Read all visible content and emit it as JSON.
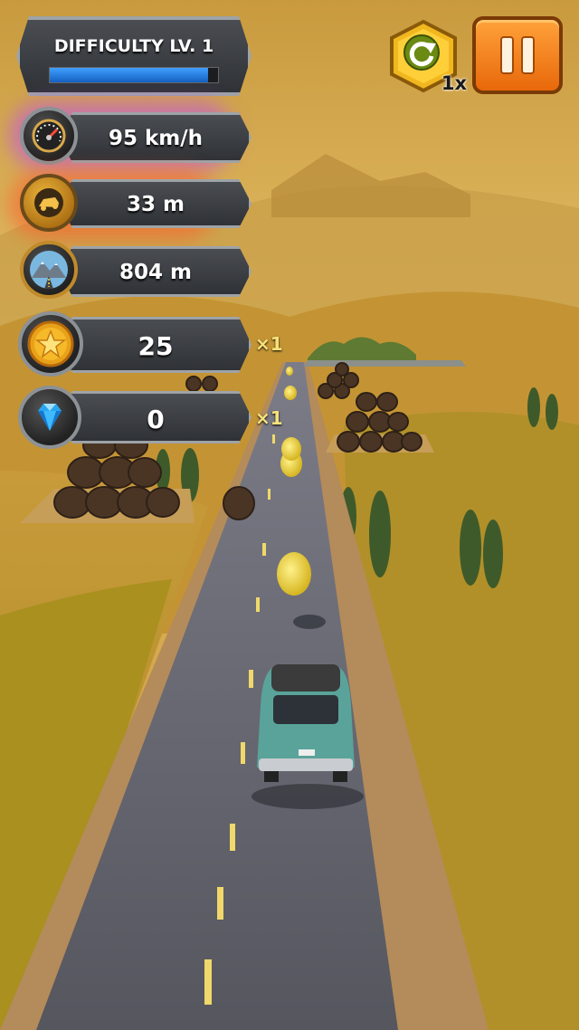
{
  "hud": {
    "difficulty": {
      "label": "DIFFICULTY LV. 1",
      "progress": 0.94,
      "bar_color": "#1e7fe0"
    },
    "speed": {
      "value": "95 km/h",
      "icon": "speedometer-icon",
      "glow": "#c04cf0"
    },
    "jump_distance": {
      "value": "33 m",
      "icon": "car-jump-icon",
      "glow": "#ff5a2a"
    },
    "distance": {
      "value": "804 m",
      "icon": "mountain-road-icon"
    },
    "coins": {
      "value": "25",
      "multiplier": "×1",
      "icon": "star-coin-icon"
    },
    "gems": {
      "value": "0",
      "multiplier": "×1",
      "icon": "diamond-icon"
    }
  },
  "controls": {
    "restart_speed_label": "1x",
    "restart_icon": "refresh-arrow-icon",
    "pause_icon": "pause-icon",
    "accent": "#f47b10"
  }
}
